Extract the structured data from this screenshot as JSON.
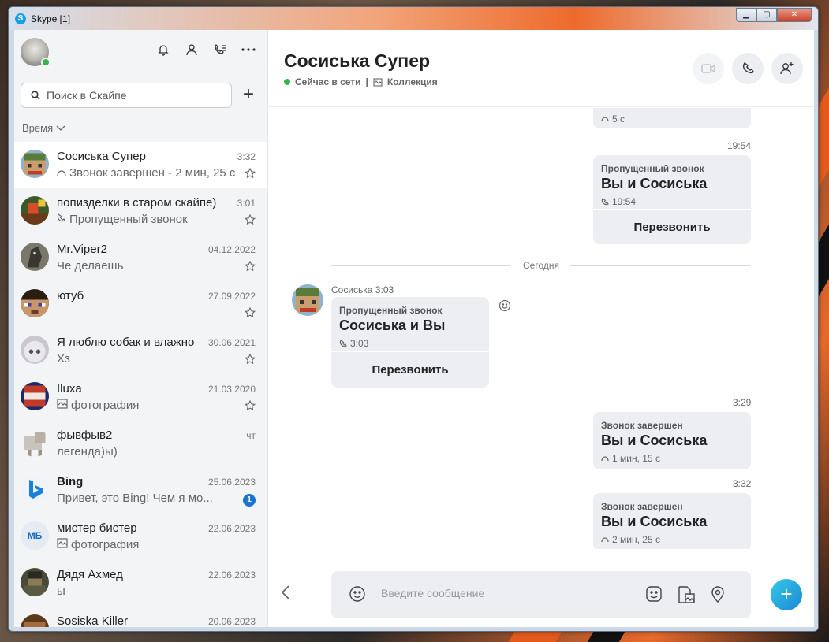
{
  "window": {
    "title": "Skype [1]"
  },
  "search": {
    "placeholder": "Поиск в Скайпе"
  },
  "sort_label": "Время",
  "chats": [
    {
      "name": "Сосиська Супер",
      "time": "3:32",
      "preview": "Звонок завершен - 2 мин, 25 с",
      "preview_icon": "call-icon",
      "bold": false,
      "pinned": true,
      "active": true,
      "avatar": "avatar-minecraft-green"
    },
    {
      "name": "попизделки в старом скайпе)",
      "time": "3:01",
      "preview": "Пропущенный звонок",
      "preview_icon": "missed-call-icon",
      "bold": false,
      "pinned": true,
      "active": false,
      "avatar": "avatar-game"
    },
    {
      "name": "Mr.Viper2",
      "time": "04.12.2022",
      "preview": "Че делаешь",
      "preview_icon": "",
      "bold": false,
      "pinned": true,
      "active": false,
      "avatar": "avatar-dog"
    },
    {
      "name": "ютуб",
      "time": "27.09.2022",
      "preview": "",
      "preview_icon": "",
      "bold": false,
      "pinned": true,
      "active": false,
      "avatar": "avatar-steve"
    },
    {
      "name": "Я люблю собак и влажно",
      "time": "30.06.2021",
      "preview": "Хз",
      "preview_icon": "",
      "bold": false,
      "pinned": true,
      "active": false,
      "avatar": "avatar-anime"
    },
    {
      "name": "Iluxa",
      "time": "21.03.2020",
      "preview": "фотография",
      "preview_icon": "image-icon",
      "bold": false,
      "pinned": true,
      "active": false,
      "avatar": "avatar-tnt"
    },
    {
      "name": "фывфыв2",
      "time": "чт",
      "preview": "легенда)ы)",
      "preview_icon": "",
      "bold": false,
      "pinned": false,
      "active": false,
      "avatar": "avatar-sheep"
    },
    {
      "name": "Bing",
      "time": "25.06.2023",
      "preview": "Привет, это Bing! Чем я мо...",
      "preview_icon": "",
      "bold": true,
      "pinned": false,
      "badge": "1",
      "active": false,
      "avatar": "avatar-bing"
    },
    {
      "name": "мистер бистер",
      "time": "22.06.2023",
      "preview": "фотография",
      "preview_icon": "image-icon",
      "bold": false,
      "pinned": false,
      "active": false,
      "avatar": "avatar-initials",
      "initials": "МБ"
    },
    {
      "name": "Дядя Ахмед",
      "time": "22.06.2023",
      "preview": "ы",
      "preview_icon": "",
      "bold": false,
      "pinned": false,
      "active": false,
      "avatar": "avatar-soldier"
    },
    {
      "name": "Sosiska Killer",
      "time": "20.06.2023",
      "preview": "",
      "preview_icon": "",
      "bold": false,
      "pinned": false,
      "active": false,
      "avatar": "avatar-minecraft-brown"
    }
  ],
  "conversation": {
    "title": "Сосиська Супер",
    "status": "Сейчас в сети",
    "separator": "|",
    "collection": "Коллекция"
  },
  "messages": {
    "partial_duration": "5 с",
    "m1": {
      "time": "19:54",
      "label": "Пропущенный звонок",
      "title": "Вы и Сосиська",
      "sub": "19:54",
      "action": "Перезвонить"
    },
    "divider": "Сегодня",
    "m2": {
      "sender": "Сосиська 3:03",
      "label": "Пропущенный звонок",
      "title": "Сосиська и Вы",
      "sub": "3:03",
      "action": "Перезвонить"
    },
    "m3": {
      "time": "3:29",
      "label": "Звонок завершен",
      "title": "Вы и Сосиська",
      "sub": "1 мин, 15 с"
    },
    "m4": {
      "time": "3:32",
      "label": "Звонок завершен",
      "title": "Вы и Сосиська",
      "sub": "2 мин, 25 с"
    }
  },
  "composer": {
    "placeholder": "Введите сообщение"
  },
  "colors": {
    "accent": "#1a8ad4",
    "online": "#36b34a",
    "bubble": "#eceef1"
  }
}
